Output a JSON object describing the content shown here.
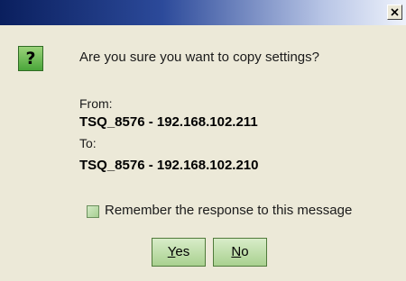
{
  "titlebar": {
    "close_label": "X"
  },
  "dialog": {
    "icon": "question-icon",
    "icon_glyph": "?",
    "question": "Are you sure you want to copy settings?",
    "from_label": "From:",
    "from_value": "TSQ_8576 - 192.168.102.211",
    "to_label": "To:",
    "to_value": "TSQ_8576 - 192.168.102.210",
    "remember_label": "Remember the response to this message",
    "remember_checked": false
  },
  "buttons": {
    "yes_label": "Yes",
    "yes_accel": "Y",
    "yes_rest": "es",
    "no_label": "No",
    "no_accel": "N",
    "no_rest": "o"
  },
  "colors": {
    "dialog_bg": "#ece9d8",
    "titlebar_dark": "#0a1f5e",
    "button_green": "#a9d18f"
  }
}
